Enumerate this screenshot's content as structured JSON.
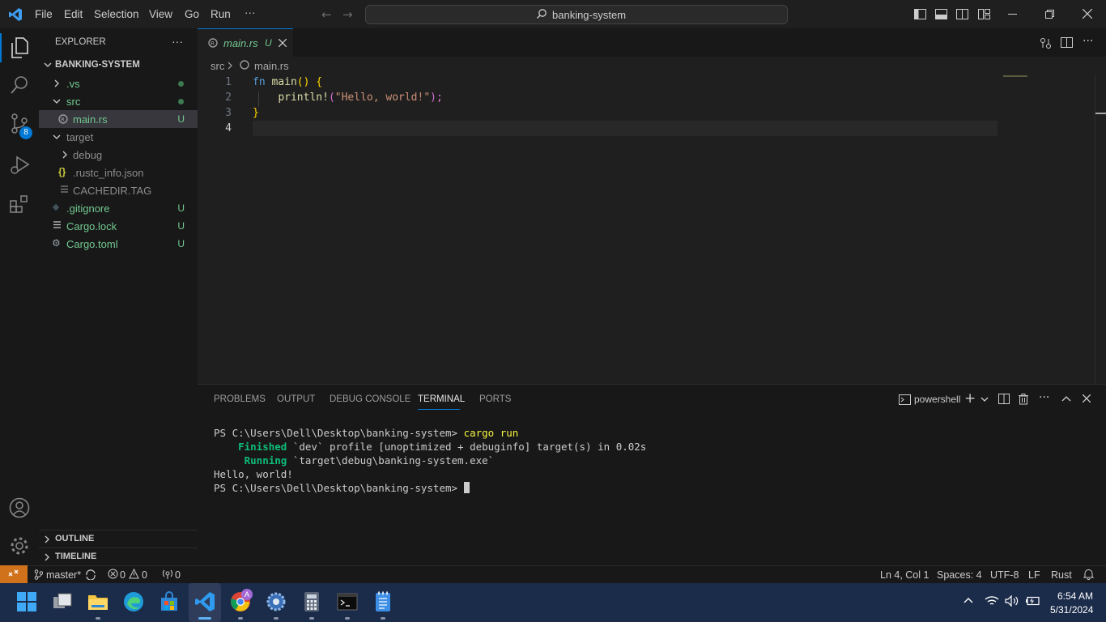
{
  "titlebar": {
    "menu": [
      "File",
      "Edit",
      "Selection",
      "View",
      "Go",
      "Run",
      "···"
    ],
    "search_text": "banking-system"
  },
  "activity": {
    "scm_badge": "8"
  },
  "sidebar": {
    "title": "EXPLORER",
    "more": "···",
    "root": "BANKING-SYSTEM",
    "items": [
      {
        "label": ".vs",
        "status": ""
      },
      {
        "label": "src",
        "status": ""
      },
      {
        "label": "main.rs",
        "status": "U"
      },
      {
        "label": "target",
        "status": ""
      },
      {
        "label": "debug",
        "status": ""
      },
      {
        "label": ".rustc_info.json",
        "status": ""
      },
      {
        "label": "CACHEDIR.TAG",
        "status": ""
      },
      {
        "label": ".gitignore",
        "status": "U"
      },
      {
        "label": "Cargo.lock",
        "status": "U"
      },
      {
        "label": "Cargo.toml",
        "status": "U"
      }
    ],
    "outline": "OUTLINE",
    "timeline": "TIMELINE"
  },
  "editor": {
    "tab": {
      "label": "main.rs",
      "status": "U"
    },
    "breadcrumb": [
      "src",
      "main.rs"
    ],
    "line_numbers": [
      "1",
      "2",
      "3",
      "4"
    ],
    "code": {
      "l1_kw": "fn",
      "l1_fn": "main",
      "l1_rest": "() {",
      "l2_macro": "println!",
      "l2_open": "(",
      "l2_str": "\"Hello, world!\"",
      "l2_close": ");",
      "l3": "}"
    }
  },
  "panel": {
    "tabs": [
      "PROBLEMS",
      "OUTPUT",
      "DEBUG CONSOLE",
      "TERMINAL",
      "PORTS"
    ],
    "shell": "powershell",
    "terminal": {
      "prompt1": "PS C:\\Users\\Dell\\Desktop\\banking-system> ",
      "cmd1": "cargo run",
      "finished_label": "    Finished",
      "finished_rest": " `dev` profile [unoptimized + debuginfo] target(s) in 0.02s",
      "running_label": "     Running",
      "running_rest": " `target\\debug\\banking-system.exe`",
      "output": "Hello, world!",
      "prompt2": "PS C:\\Users\\Dell\\Desktop\\banking-system> "
    }
  },
  "statusbar": {
    "branch": "master*",
    "errors": "0",
    "warnings": "0",
    "ports": "0",
    "position": "Ln 4, Col 1",
    "spaces": "Spaces: 4",
    "encoding": "UTF-8",
    "eol": "LF",
    "language": "Rust"
  },
  "taskbar": {
    "time": "6:54 AM",
    "date": "5/31/2024",
    "chrome_badge": "A"
  },
  "colors": {
    "accent": "#0078d4",
    "keyword": "#569cd6",
    "function": "#dcdcaa",
    "string": "#ce9178",
    "brace": "#ffd700",
    "untracked": "#73c991",
    "terminal_green": "#0dbc79"
  }
}
